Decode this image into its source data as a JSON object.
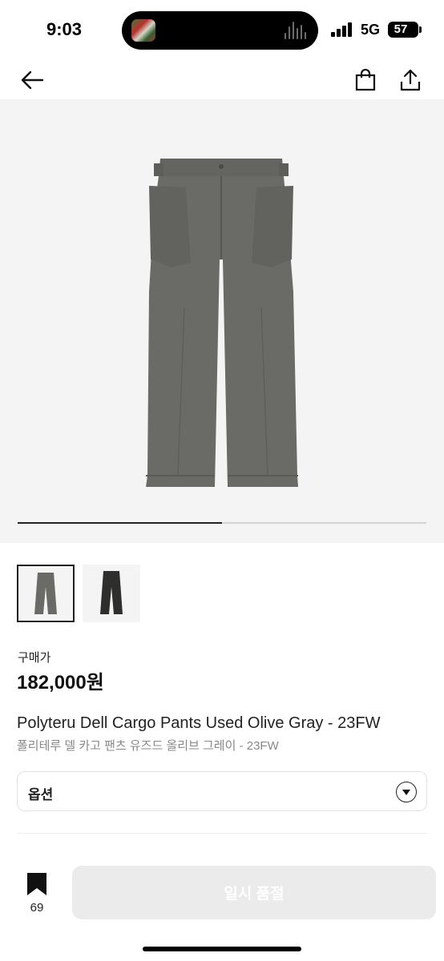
{
  "status_bar": {
    "time": "9:03",
    "network": "5G",
    "battery": "57"
  },
  "nav": {
    "back_icon": "arrow-left-icon",
    "bag_icon": "shopping-bag-icon",
    "share_icon": "share-icon"
  },
  "gallery": {
    "current_image": 1,
    "total_images": 2,
    "progress_fraction": 0.5,
    "pants_colors": [
      "#6a6b66",
      "#2e2f2d"
    ]
  },
  "product": {
    "price_label": "구매가",
    "price": "182,000원",
    "name_en": "Polyteru Dell Cargo Pants Used Olive Gray - 23FW",
    "name_ko": "폴리테루 델 카고 팬츠 유즈드 올리브 그레이 - 23FW"
  },
  "option": {
    "label": "옵션",
    "caret_icon": "chevron-down-circle-icon"
  },
  "bottom_bar": {
    "bookmark_icon": "bookmark-icon",
    "bookmark_count": "69",
    "action_label": "일시 품절"
  },
  "colors": {
    "accent": "#222222",
    "disabled_button": "#ebebeb",
    "image_bg": "#f4f4f4"
  }
}
